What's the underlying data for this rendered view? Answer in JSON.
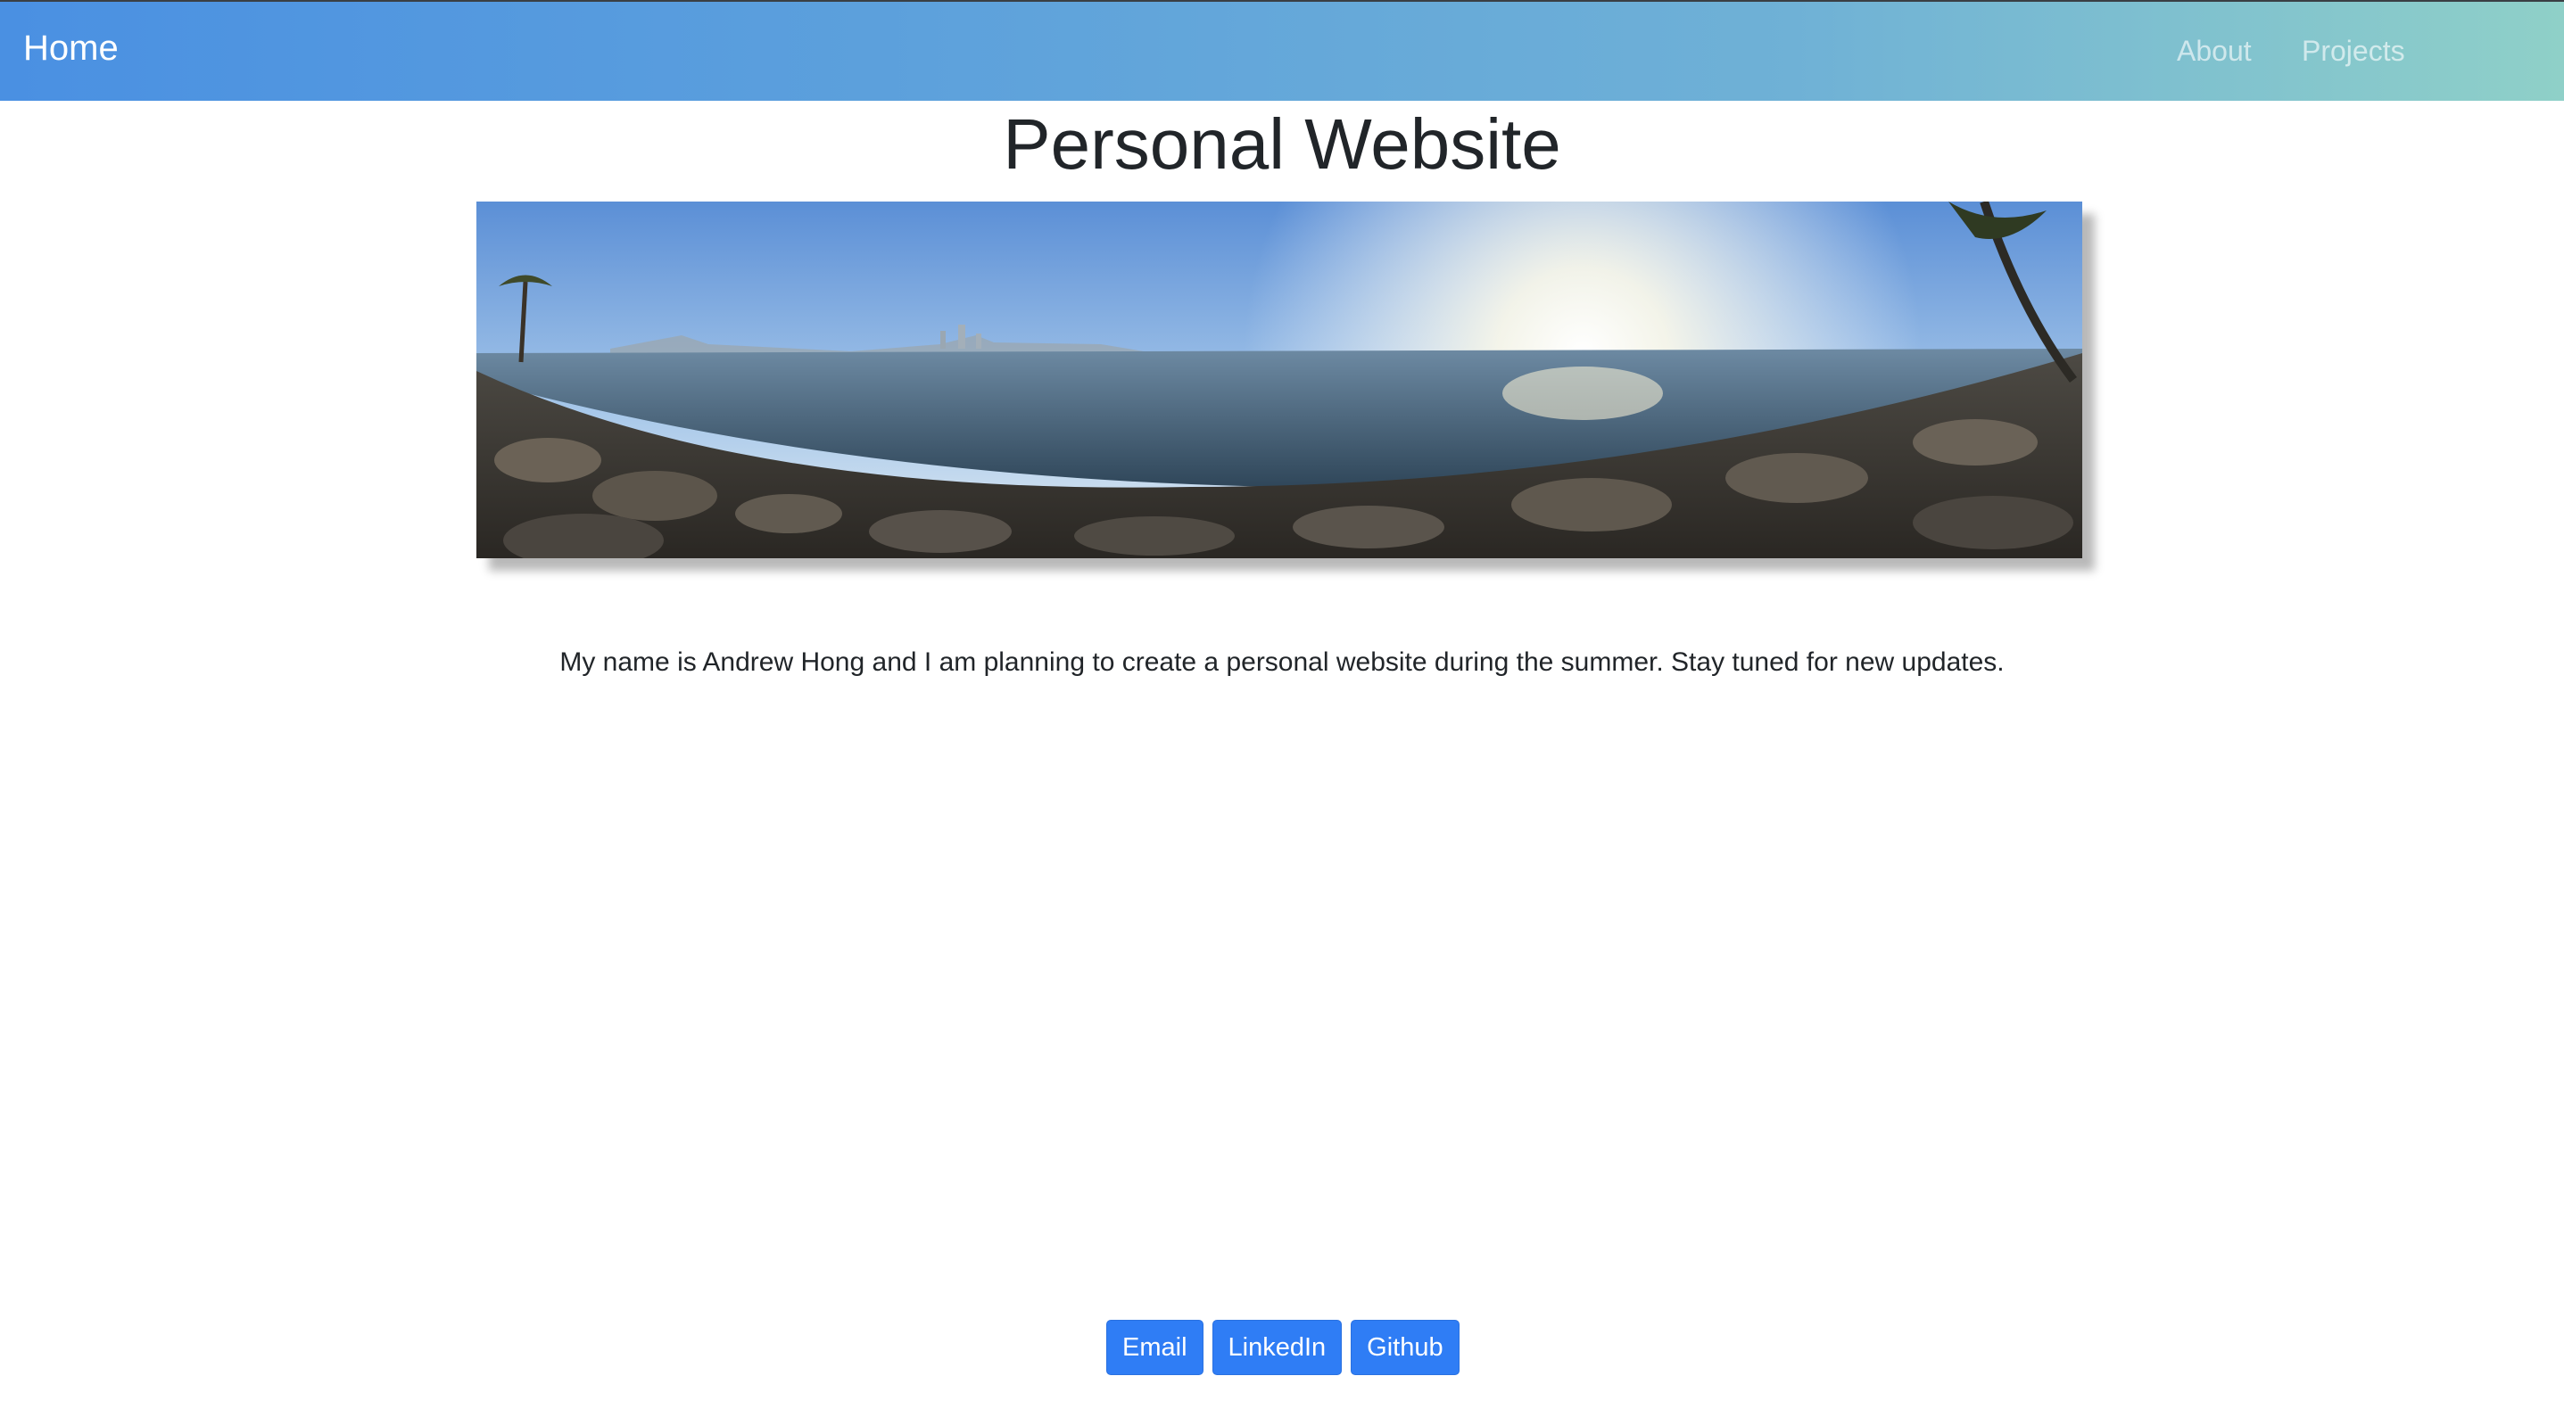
{
  "navbar": {
    "brand": "Home",
    "links": [
      {
        "label": "About"
      },
      {
        "label": "Projects"
      }
    ]
  },
  "main": {
    "title": "Personal Website",
    "hero_image_icon": "panorama-photo-bay-skyline",
    "intro": "My name is Andrew Hong and I am planning to create a personal website during the summer. Stay tuned for new updates."
  },
  "footer": {
    "buttons": [
      {
        "label": "Email"
      },
      {
        "label": "LinkedIn"
      },
      {
        "label": "Github"
      }
    ]
  },
  "colors": {
    "nav_gradient_start": "#4a90e2",
    "nav_gradient_end": "#8fd0c8",
    "button": "#2f7df5",
    "text": "#212529"
  }
}
